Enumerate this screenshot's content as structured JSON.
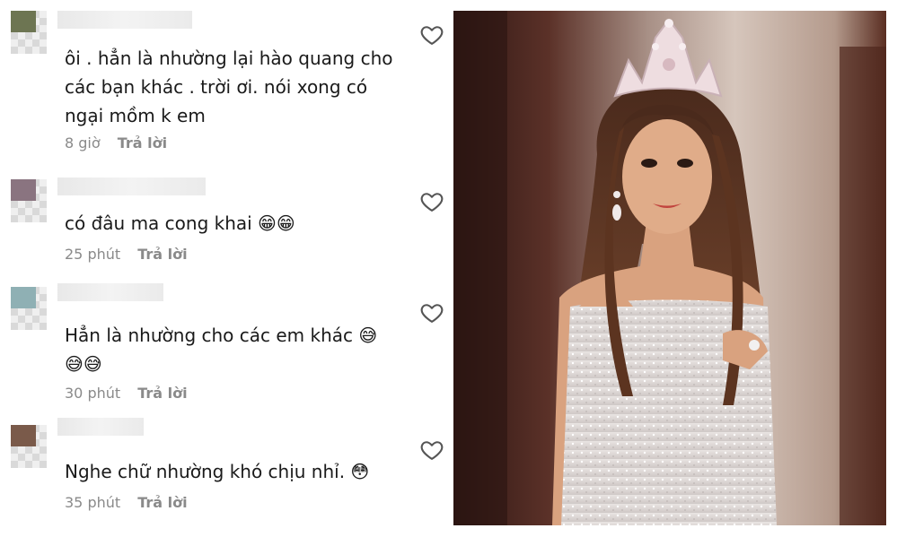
{
  "comments": [
    {
      "text": "ôi . hẳn là nhường lại hào quang cho các bạn khác . trời ơi. nói xong có ngại mồm k em",
      "time": "8 giờ",
      "reply_label": "Trả lời"
    },
    {
      "text": "có đâu ma cong khai 😁😁",
      "time": "25 phút",
      "reply_label": "Trả lời"
    },
    {
      "text": "Hẳn là nhường cho các em khác 😅 😅😅",
      "time": "30 phút",
      "reply_label": "Trả lời"
    },
    {
      "text": "Nghe chữ nhường khó chịu nhỉ. 😳",
      "time": "35 phút",
      "reply_label": "Trả lời"
    }
  ],
  "icons": {
    "like": "heart-outline-icon"
  },
  "colors": {
    "text": "#1a1a1a",
    "meta": "#8a8a8a",
    "icon": "#555555"
  }
}
